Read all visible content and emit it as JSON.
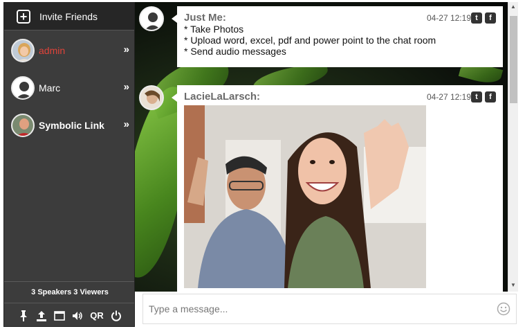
{
  "sidebar": {
    "invite_label": "Invite Friends",
    "users": [
      {
        "name": "admin",
        "chevron": "»"
      },
      {
        "name": "Marc",
        "chevron": "»"
      },
      {
        "name": "Symbolic Link",
        "chevron": "»"
      }
    ],
    "counts": "3 Speakers 3 Viewers",
    "tools": {
      "qr_label": "QR"
    }
  },
  "messages": [
    {
      "sender": "Just Me:",
      "time": "04-27 12:19",
      "lines": [
        "* Take Photos",
        "* Upload word, excel, pdf and power point to the chat room",
        "* Send audio messages"
      ]
    },
    {
      "sender": "LacieLaLarsch:",
      "time": "04-27 12:19"
    }
  ],
  "share": {
    "twitter": "t",
    "facebook": "f"
  },
  "composer": {
    "placeholder": "Type a message..."
  },
  "colors": {
    "sidebar_bg": "#3c3c3c",
    "admin_name": "#e0433a",
    "bubble_bg": "#ffffff"
  }
}
